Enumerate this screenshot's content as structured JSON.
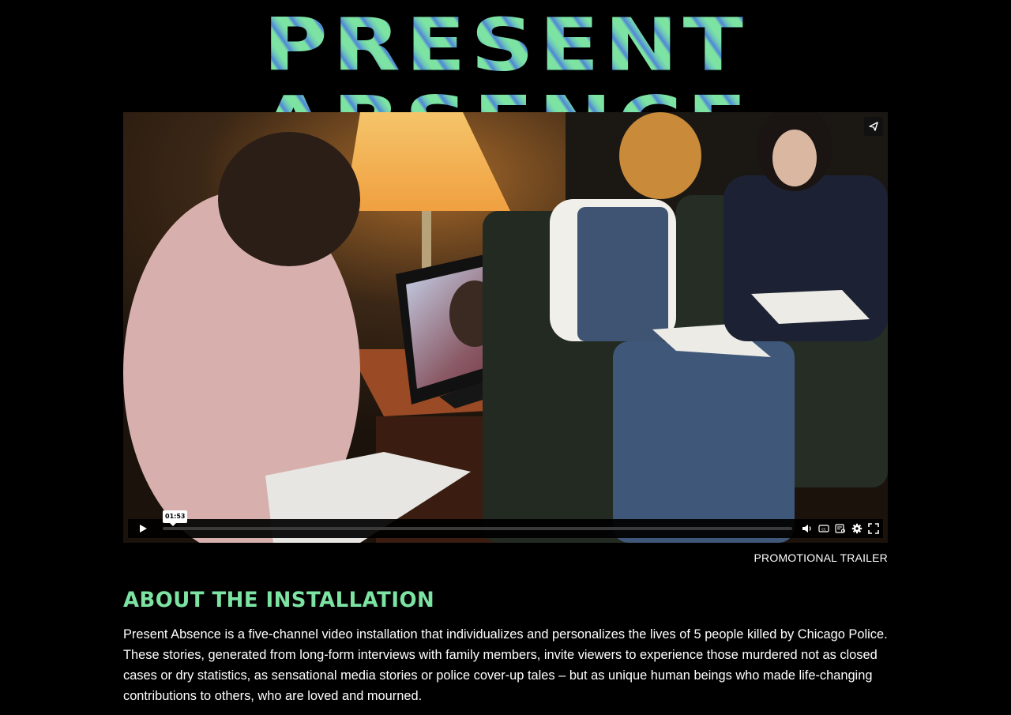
{
  "site": {
    "title": "PRESENT ABSENCE"
  },
  "video": {
    "current_time": "01:53",
    "progress": 0.0,
    "caption": "PROMOTIONAL TRAILER",
    "icons": [
      "share-icon",
      "play-icon",
      "volume-icon",
      "closed-captions-icon",
      "transcript-icon",
      "settings-gear-icon",
      "fullscreen-icon"
    ]
  },
  "about": {
    "heading": "ABOUT THE INSTALLATION",
    "body": "Present Absence is a five-channel video installation that individualizes and personalizes the lives of 5 people killed by Chicago Police. These stories, generated from long-form interviews with family members, invite viewers to experience those murdered not as closed cases or dry statistics, as sensational media stories or police cover-up tales – but as unique human beings who made life-changing contributions to others, who are loved and mourned."
  },
  "colors": {
    "accent": "#7de3a3",
    "title_blue": "#4f86d6",
    "background": "#000000"
  }
}
